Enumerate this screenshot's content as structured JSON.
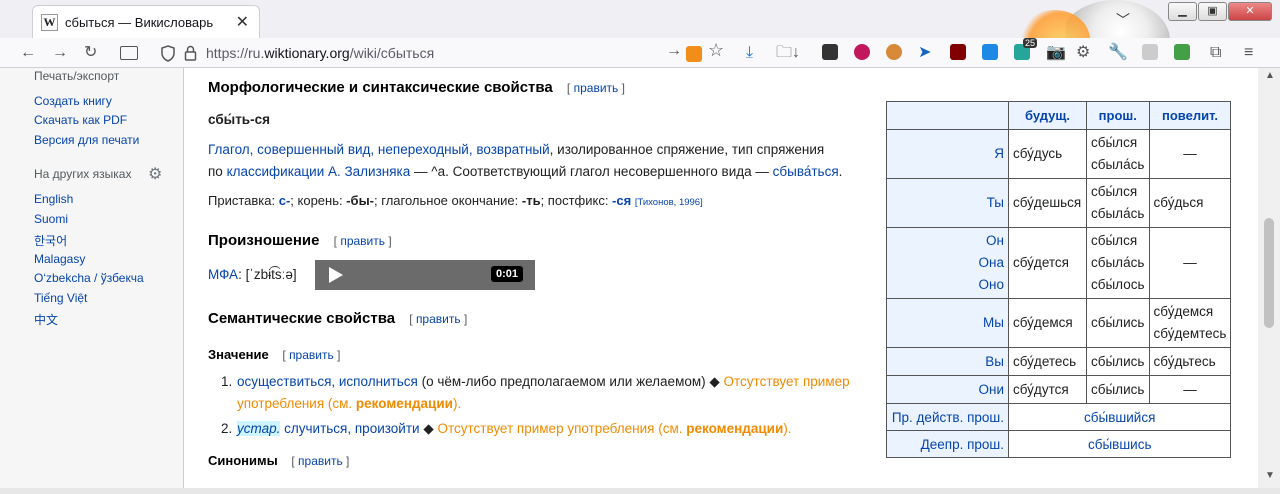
{
  "browser": {
    "tab_title": "сбыться — Викисловарь",
    "favicon": "W",
    "tab_close": "✕",
    "url_prefix": "https://ru.",
    "url_domain": "wiktionary.org",
    "url_path": "/wiki/сбыться",
    "tabs_dropdown": "﹀",
    "badge_count": "25",
    "window_buttons": [
      "▁",
      "▣",
      "✕"
    ]
  },
  "sidebar": {
    "print_heading": "Печать/экспорт",
    "print_links": [
      "Создать книгу",
      "Скачать как PDF",
      "Версия для печати"
    ],
    "lang_heading": "На других языках",
    "lang_links": [
      "English",
      "Suomi",
      "한국어",
      "Malagasy",
      "O‘zbekcha / ўзбекча",
      "Tiếng Việt",
      "中文"
    ]
  },
  "article": {
    "morph_heading": "Морфологические и синтаксические свойства",
    "edit_label": "править",
    "word": "сбы́ть-ся",
    "line1_a": "Глагол, совершенный вид, непереходный, возвратный",
    "line1_b": ", изолированное спряжение, тип спряжения",
    "line2_a": "по ",
    "line2_link": "классификации А. Зализняка",
    "line2_b": " — ",
    "line2_c": "^а. Соответствующий глагол несовершенного вида — ",
    "line2_link2": "сбыва́ться",
    "line2_end": ".",
    "morph_line": "Приставка: ",
    "prefix": "с-",
    "root_label": "; корень: ",
    "root": "-бы-",
    "ending_label": "; глагольное окончание: ",
    "ending": "-ть",
    "postfix_label": "; постфикс: ",
    "postfix": "-ся",
    "ref": "[Тихонов, 1996]",
    "pron_heading": "Произношение",
    "ipa_label": "МФА",
    "ipa": ": [ˈzbɨt͡sːə]",
    "audio_time": "0:01",
    "sem_heading": "Семантические свойства",
    "meaning_heading": "Значение",
    "m1_num": "1.",
    "m1_link": "осуществиться, исполниться",
    "m1_text": " (о чём-либо предполагаемом или желаемом) ◆ ",
    "m1_missing": "Отсутствует пример употребления (см. ",
    "m1_rec": "рекомендации",
    "m1_close": ").",
    "m2_num": "2.",
    "m2_tag": "устар.",
    "m2_link": "случиться, произойти",
    "m2_text": " ◆ ",
    "m2_missing": "Отсутствует пример употребления (см. ",
    "m2_rec": "рекомендации",
    "m2_close": ").",
    "syn_heading": "Синонимы"
  },
  "conjugation": {
    "headers": [
      "будущ.",
      "прош.",
      "повелит."
    ],
    "rows": [
      {
        "pron": "Я",
        "fut": "сбу́дусь",
        "past": "сбы́лся\nсбыла́сь",
        "imp": "—"
      },
      {
        "pron": "Ты",
        "fut": "сбу́дешься",
        "past": "сбы́лся\nсбыла́сь",
        "imp": "сбу́дься"
      },
      {
        "pron": "Он\nОна\nОно",
        "fut": "сбу́дется",
        "past": "сбы́лся\nсбыла́сь\nсбы́лось",
        "imp": "—"
      },
      {
        "pron": "Мы",
        "fut": "сбу́демся",
        "past": "сбы́лись",
        "imp": "сбу́демся\nсбу́демтесь"
      },
      {
        "pron": "Вы",
        "fut": "сбу́детесь",
        "past": "сбы́лись",
        "imp": "сбу́дьтесь"
      },
      {
        "pron": "Они",
        "fut": "сбу́дутся",
        "past": "сбы́лись",
        "imp": "—"
      }
    ],
    "participle_label": "Пр. действ. прош.",
    "participle": "сбы́вшийся",
    "gerund_label": "Деепр. прош.",
    "gerund": "сбы́вшись"
  }
}
